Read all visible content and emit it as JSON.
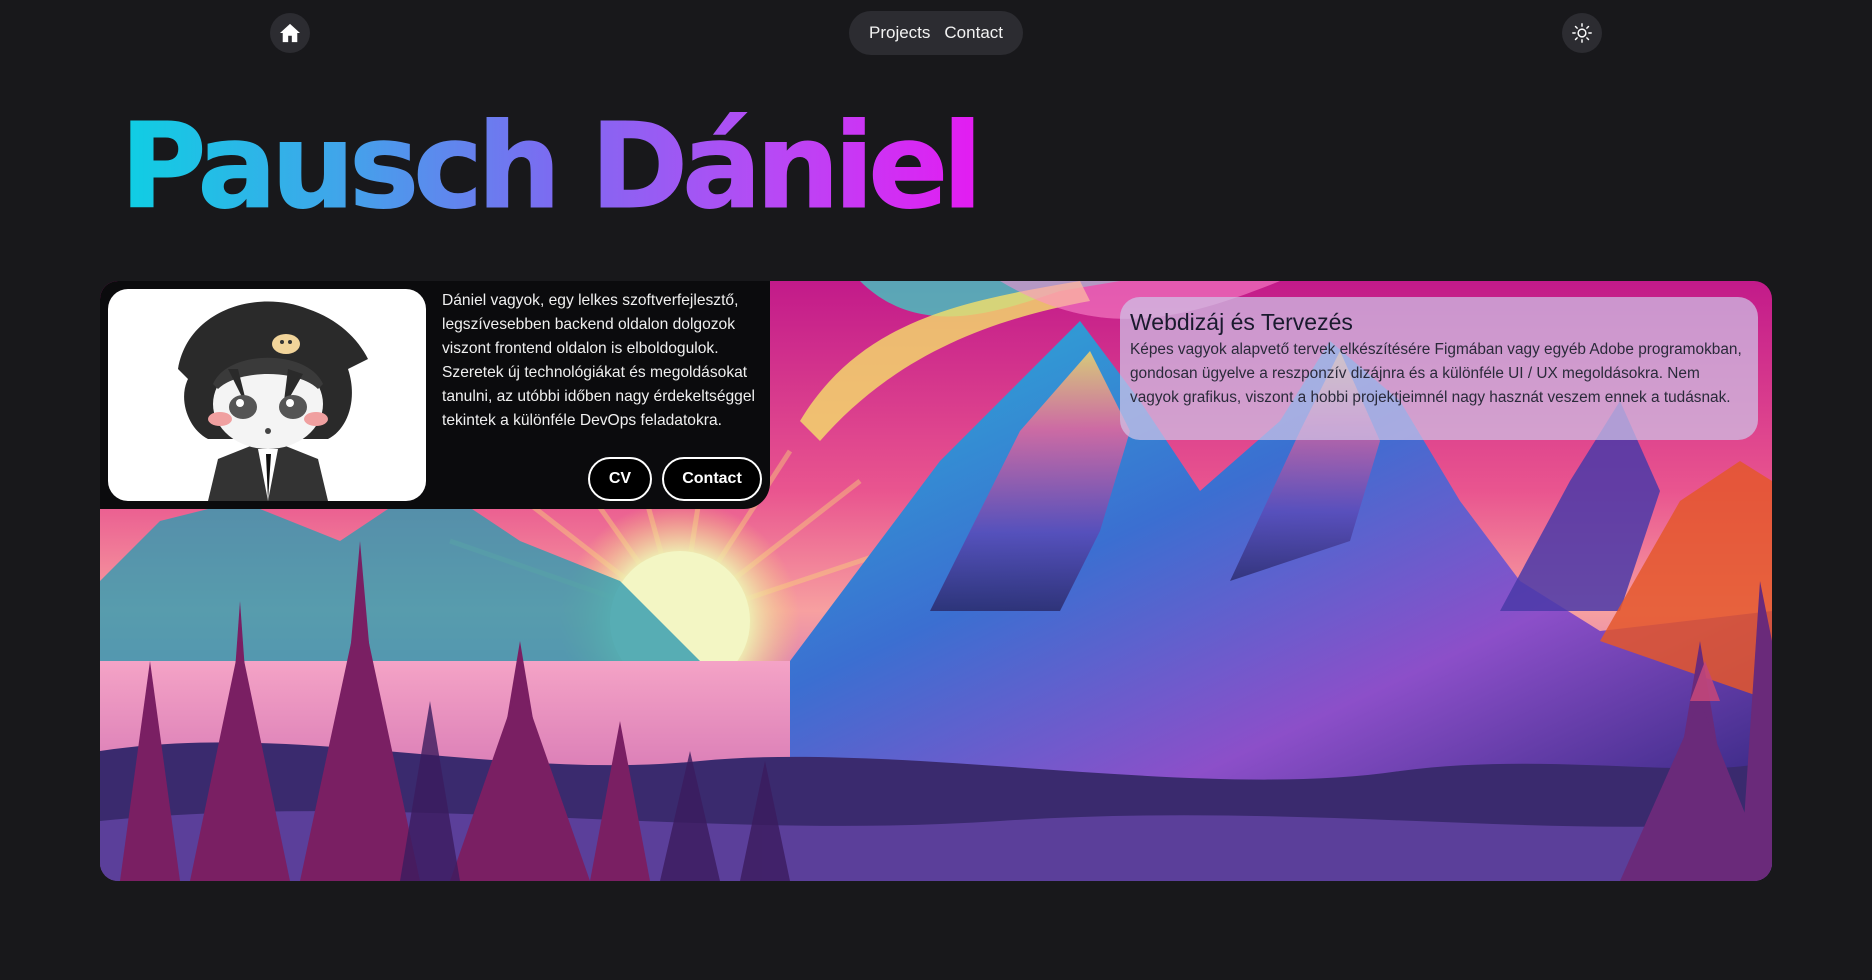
{
  "nav": {
    "home_icon": "home-icon",
    "links": [
      "Projects",
      "Contact"
    ],
    "theme_icon": "sun-icon"
  },
  "hero": {
    "name": "Pausch Dániel",
    "gradient": [
      "#0ecfe3",
      "#7b6cf1",
      "#e31cf2"
    ]
  },
  "intro": {
    "text": "Dániel vagyok, egy lelkes szoftverfejlesztő, legszívesebben backend oldalon dolgozok viszont frontend oldalon is elboldogulok. Szeretek új technológiákat és megoldásokat tanulni, az utóbbi időben nagy érdekeltséggel tekintek a különféle DevOps feladatokra.",
    "cv_label": "CV",
    "contact_label": "Contact"
  },
  "card": {
    "title": "Webdizáj és Tervezés",
    "text": "Képes vagyok alapvető tervek elkészítésére Figmában vagy egyéb Adobe programokban, gondosan ügyelve a reszponzív dizájnra és a különféle UI / UX megoldásokra. Nem vagyok grafikus, viszont a hobbi projektjeimnél nagy hasznát veszem ennek a tudásnak."
  },
  "colors": {
    "background": "#18181b",
    "nav_bg": "#2c2c31"
  }
}
